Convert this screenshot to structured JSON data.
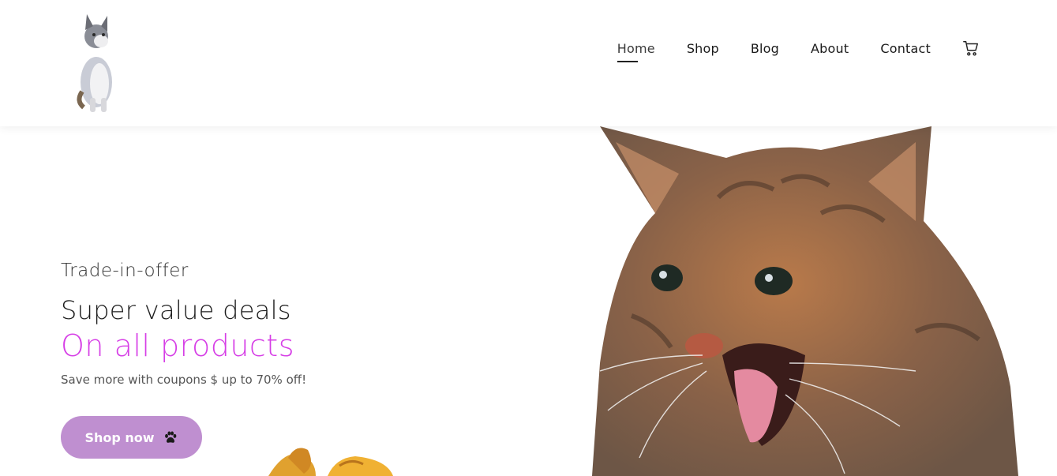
{
  "brand": {
    "logo_icon": "cat-logo-icon"
  },
  "nav": {
    "items": [
      {
        "label": "Home",
        "active": true
      },
      {
        "label": "Shop",
        "active": false
      },
      {
        "label": "Blog",
        "active": false
      },
      {
        "label": "About",
        "active": false
      },
      {
        "label": "Contact",
        "active": false
      }
    ],
    "cart_icon": "cart-icon"
  },
  "hero": {
    "kicker": "Trade-in-offer",
    "headline": "Super value deals",
    "subhead": "On all products",
    "description": "Save more with coupons $ up to 70% off!",
    "cta_label": "Shop now",
    "cta_icon": "paw-icon",
    "image_icon": "kitten-image"
  },
  "colors": {
    "accent": "#d63ee6",
    "button": "#bf8fd0",
    "text": "#1a1a1a"
  }
}
